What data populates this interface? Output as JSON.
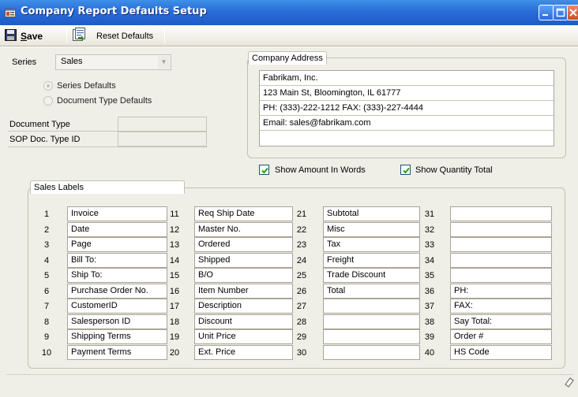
{
  "window": {
    "title": "Company Report Defaults Setup"
  },
  "toolbar": {
    "save_label": "Save",
    "save_label_rest": "ave",
    "save_label_first": "S",
    "reset_label": "Reset Defaults"
  },
  "series": {
    "label": "Series",
    "value": "Sales"
  },
  "options": {
    "series_defaults": "Series Defaults",
    "doc_type_defaults": "Document Type Defaults",
    "selected": "series_defaults"
  },
  "fields": {
    "document_type_label": "Document Type",
    "sop_doc_type_label": "SOP Doc. Type ID"
  },
  "address": {
    "title": "Company Address",
    "lines": [
      "Fabrikam, Inc.",
      "123 Main St, Bloomington, IL 61777",
      "PH: (333)-222-1212 FAX: (333)-227-4444",
      "Email: sales@fabrikam.com",
      ""
    ]
  },
  "checkboxes": {
    "show_amount_in_words": "Show Amount In Words",
    "show_quantity_total": "Show Quantity Total",
    "show_amount_checked": true,
    "show_quantity_checked": true
  },
  "sales_labels": {
    "title": "Sales Labels",
    "columns": [
      [
        {
          "n": "1",
          "v": "Invoice"
        },
        {
          "n": "2",
          "v": "Date"
        },
        {
          "n": "3",
          "v": "Page"
        },
        {
          "n": "4",
          "v": "Bill To:"
        },
        {
          "n": "5",
          "v": "Ship To:"
        },
        {
          "n": "6",
          "v": "Purchase Order No."
        },
        {
          "n": "7",
          "v": "CustomerID"
        },
        {
          "n": "8",
          "v": "Salesperson ID"
        },
        {
          "n": "9",
          "v": "Shipping Terms"
        },
        {
          "n": "10",
          "v": "Payment Terms"
        }
      ],
      [
        {
          "n": "11",
          "v": "Req Ship Date"
        },
        {
          "n": "12",
          "v": "Master No."
        },
        {
          "n": "13",
          "v": "Ordered"
        },
        {
          "n": "14",
          "v": "Shipped"
        },
        {
          "n": "15",
          "v": "B/O"
        },
        {
          "n": "16",
          "v": "Item Number"
        },
        {
          "n": "17",
          "v": "Description"
        },
        {
          "n": "18",
          "v": "Discount"
        },
        {
          "n": "19",
          "v": "Unit Price"
        },
        {
          "n": "20",
          "v": "Ext. Price"
        }
      ],
      [
        {
          "n": "21",
          "v": "Subtotal"
        },
        {
          "n": "22",
          "v": "Misc"
        },
        {
          "n": "23",
          "v": "Tax"
        },
        {
          "n": "24",
          "v": "Freight"
        },
        {
          "n": "25",
          "v": "Trade Discount"
        },
        {
          "n": "26",
          "v": "Total"
        },
        {
          "n": "27",
          "v": ""
        },
        {
          "n": "28",
          "v": ""
        },
        {
          "n": "29",
          "v": ""
        },
        {
          "n": "30",
          "v": ""
        }
      ],
      [
        {
          "n": "31",
          "v": ""
        },
        {
          "n": "32",
          "v": ""
        },
        {
          "n": "33",
          "v": ""
        },
        {
          "n": "34",
          "v": ""
        },
        {
          "n": "35",
          "v": ""
        },
        {
          "n": "36",
          "v": "PH:"
        },
        {
          "n": "37",
          "v": "FAX:"
        },
        {
          "n": "38",
          "v": "Say Total:"
        },
        {
          "n": "39",
          "v": "Order #"
        },
        {
          "n": "40",
          "v": "HS Code"
        }
      ]
    ]
  }
}
